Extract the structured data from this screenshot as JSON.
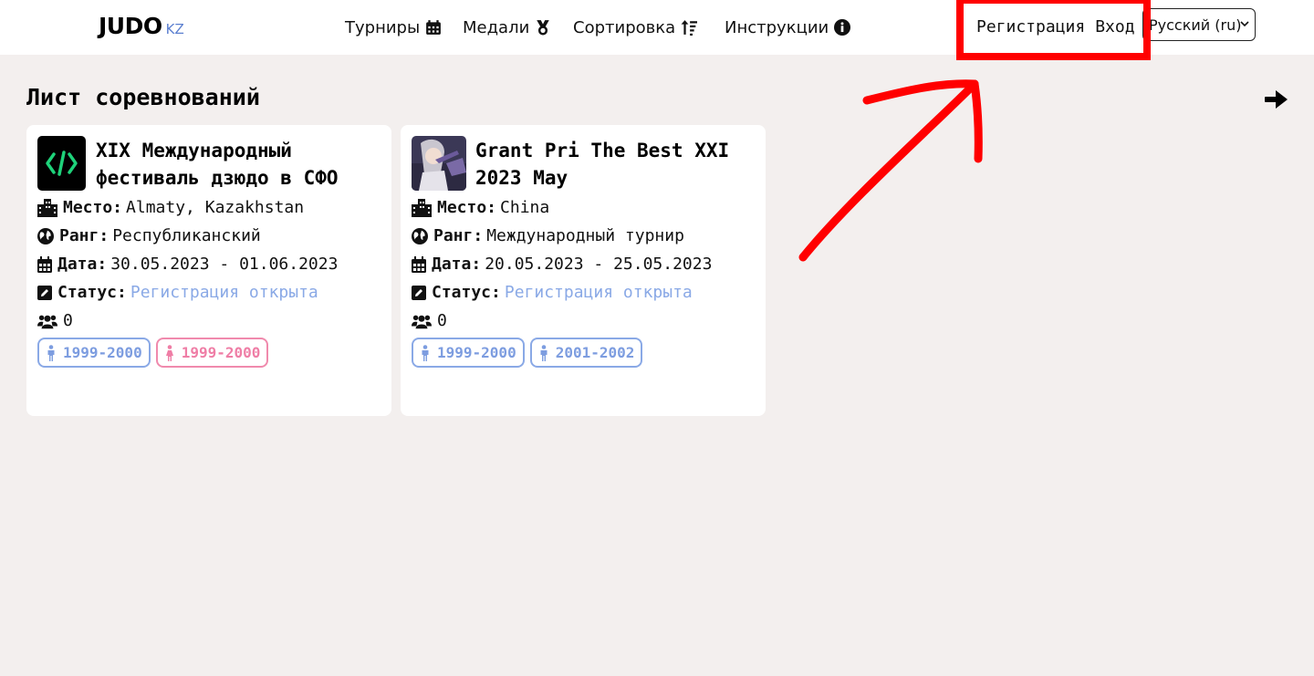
{
  "header": {
    "logo_main": "JUDO",
    "logo_sub": "KZ",
    "nav": [
      {
        "label": "Турниры",
        "icon": "calendar-icon"
      },
      {
        "label": "Медали",
        "icon": "medal-icon"
      },
      {
        "label": "Сортировка",
        "icon": "sort-icon"
      },
      {
        "label": "Инструкции",
        "icon": "info-icon"
      }
    ],
    "register_label": "Регистрация",
    "login_label": "Вход",
    "language_selected": "Русский (ru)"
  },
  "main": {
    "title": "Лист соревнований",
    "field_labels": {
      "place": "Место:",
      "rank": "Ранг:",
      "date": "Дата:",
      "status": "Статус:"
    },
    "tournaments": [
      {
        "title_line1": "XIX Международный",
        "title_line2": "фестиваль дзюдо в СФО",
        "place": "Almaty, Kazakhstan",
        "rank": "Республиканский",
        "date": "30.05.2023 - 01.06.2023",
        "status": "Регистрация открыта",
        "participants": "0",
        "categories": [
          {
            "label": "1999-2000",
            "gender": "male"
          },
          {
            "label": "1999-2000",
            "gender": "female"
          }
        ]
      },
      {
        "title_line1": "Grant Pri The Best XXI",
        "title_line2": "2023 May",
        "place": "China",
        "rank": "Международный турнир",
        "date": "20.05.2023 - 25.05.2023",
        "status": "Регистрация открыта",
        "participants": "0",
        "categories": [
          {
            "label": "1999-2000",
            "gender": "male"
          },
          {
            "label": "2001-2002",
            "gender": "male"
          }
        ]
      }
    ]
  },
  "colors": {
    "accent_blue": "#8aa9e6",
    "accent_pink": "#f08aad",
    "highlight": "#ff0000",
    "page_bg": "#f3efee"
  }
}
